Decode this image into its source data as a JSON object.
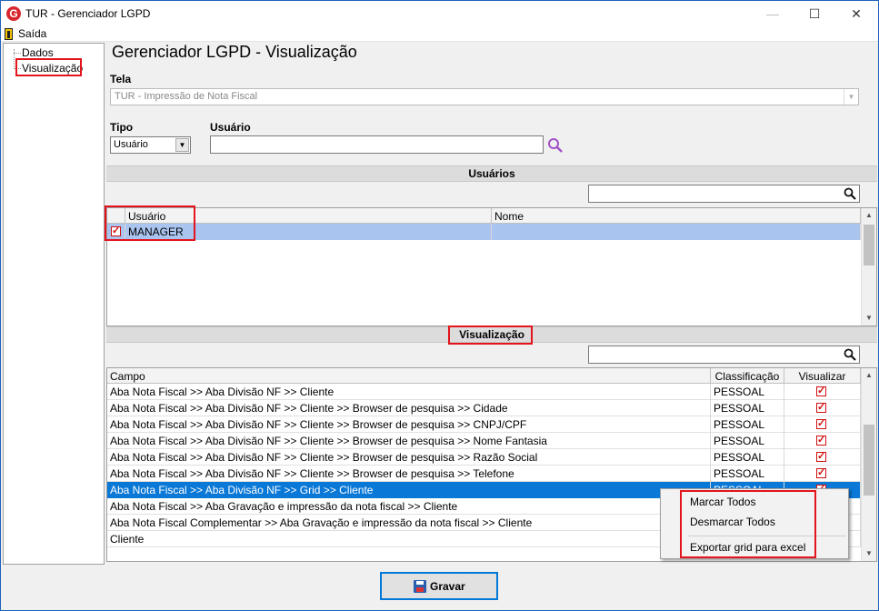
{
  "window": {
    "title": "TUR - Gerenciador LGPD",
    "icon": "app-logo-icon"
  },
  "menu": {
    "exit_label": "Saída"
  },
  "tree": {
    "items": [
      {
        "label": "Dados"
      },
      {
        "label": "Visualização"
      }
    ]
  },
  "page": {
    "heading": "Gerenciador LGPD - Visualização"
  },
  "form": {
    "tela_label": "Tela",
    "tela_value": "TUR - Impressão de Nota Fiscal",
    "tipo_label": "Tipo",
    "tipo_value": "Usuário",
    "usuario_label": "Usuário",
    "usuario_value": ""
  },
  "users_section": {
    "title": "Usuários",
    "search_value": "",
    "columns": [
      "Usuário",
      "Nome"
    ],
    "rows": [
      {
        "checked": true,
        "usuario": "MANAGER",
        "nome": ""
      }
    ]
  },
  "view_section": {
    "title": "Visualização",
    "search_value": "",
    "columns": [
      "Campo",
      "Classificação",
      "Visualizar"
    ],
    "rows": [
      {
        "campo": "Aba Nota Fiscal >> Aba Divisão NF >> Cliente",
        "classificacao": "PESSOAL",
        "visualizar": true
      },
      {
        "campo": "Aba Nota Fiscal >> Aba Divisão NF >> Cliente >> Browser de pesquisa >> Cidade",
        "classificacao": "PESSOAL",
        "visualizar": true
      },
      {
        "campo": "Aba Nota Fiscal >> Aba Divisão NF >> Cliente >> Browser de pesquisa >> CNPJ/CPF",
        "classificacao": "PESSOAL",
        "visualizar": true
      },
      {
        "campo": "Aba Nota Fiscal >> Aba Divisão NF >> Cliente >> Browser de pesquisa >> Nome Fantasia",
        "classificacao": "PESSOAL",
        "visualizar": true
      },
      {
        "campo": "Aba Nota Fiscal >> Aba Divisão NF >> Cliente >> Browser de pesquisa >> Razão Social",
        "classificacao": "PESSOAL",
        "visualizar": true
      },
      {
        "campo": "Aba Nota Fiscal >> Aba Divisão NF >> Cliente >> Browser de pesquisa >> Telefone",
        "classificacao": "PESSOAL",
        "visualizar": true
      },
      {
        "campo": "Aba Nota Fiscal >> Aba Divisão NF >> Grid >> Cliente",
        "classificacao": "PESSOAL",
        "visualizar": true,
        "selected": true
      },
      {
        "campo": "Aba Nota Fiscal >> Aba Gravação e impressão da nota fiscal >> Cliente",
        "classificacao": "",
        "visualizar": false
      },
      {
        "campo": "Aba Nota Fiscal Complementar >> Aba Gravação e impressão da nota fiscal >> Cliente",
        "classificacao": "",
        "visualizar": false
      },
      {
        "campo": "Cliente",
        "classificacao": "",
        "visualizar": false
      }
    ]
  },
  "context_menu": {
    "items": [
      "Marcar Todos",
      "Desmarcar Todos",
      "Exportar grid para excel"
    ]
  },
  "save_button": {
    "label": "Gravar"
  },
  "colors": {
    "highlight": "#e3141b",
    "selection": "#0a78d7",
    "user_selection": "#a9c4ef"
  }
}
